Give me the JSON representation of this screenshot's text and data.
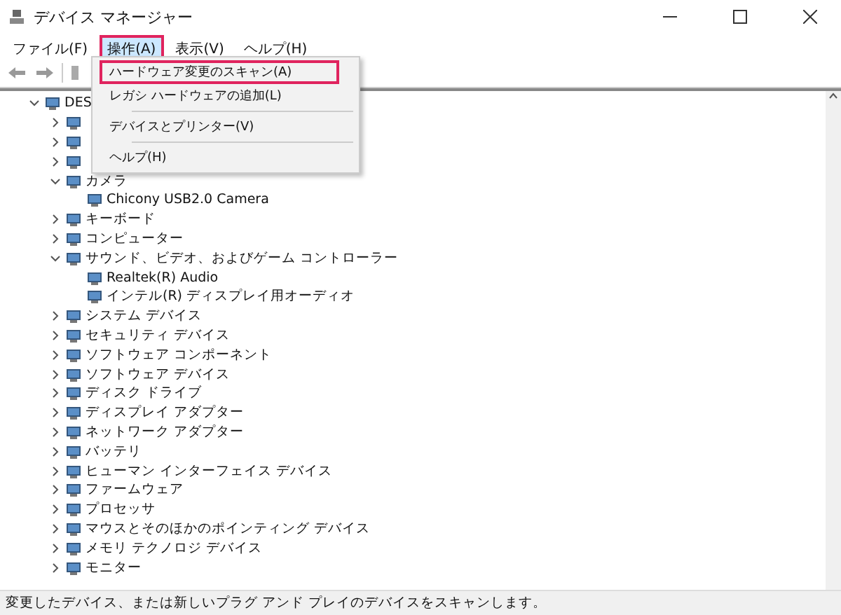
{
  "window": {
    "title": "デバイス マネージャー"
  },
  "menu_bar": [
    {
      "label": "ファイル(F)",
      "selected": false
    },
    {
      "label": "操作(A)",
      "selected": true
    },
    {
      "label": "表示(V)",
      "selected": false
    },
    {
      "label": "ヘルプ(H)",
      "selected": false
    }
  ],
  "dropdown": [
    {
      "kind": "item",
      "label": "ハードウェア変更のスキャン(A)",
      "highlighted": true
    },
    {
      "kind": "item",
      "label": "レガシ ハードウェアの追加(L)",
      "highlighted": false
    },
    {
      "kind": "separator"
    },
    {
      "kind": "item",
      "label": "デバイスとプリンター(V)",
      "highlighted": false
    },
    {
      "kind": "separator"
    },
    {
      "kind": "item",
      "label": "ヘルプ(H)",
      "highlighted": false
    }
  ],
  "tree": [
    {
      "label": "DES",
      "expanded": true,
      "children": [
        {
          "expanded": false
        },
        {
          "expanded": false
        },
        {
          "expanded": false
        },
        {
          "label": "カメラ",
          "expanded": true,
          "children": [
            {
              "label": "Chicony USB2.0 Camera"
            }
          ]
        },
        {
          "label": "キーボード",
          "expanded": false
        },
        {
          "label": "コンピューター",
          "expanded": false
        },
        {
          "label": "サウンド、ビデオ、およびゲーム コントローラー",
          "expanded": true,
          "children": [
            {
              "label": "Realtek(R) Audio"
            },
            {
              "label": "インテル(R) ディスプレイ用オーディオ"
            }
          ]
        },
        {
          "label": "システム デバイス",
          "expanded": false
        },
        {
          "label": "セキュリティ デバイス",
          "expanded": false
        },
        {
          "label": "ソフトウェア コンポーネント",
          "expanded": false
        },
        {
          "label": "ソフトウェア デバイス",
          "expanded": false
        },
        {
          "label": "ディスク ドライブ",
          "expanded": false
        },
        {
          "label": "ディスプレイ アダプター",
          "expanded": false
        },
        {
          "label": "ネットワーク アダプター",
          "expanded": false
        },
        {
          "label": "バッテリ",
          "expanded": false
        },
        {
          "label": "ヒューマン インターフェイス デバイス",
          "expanded": false
        },
        {
          "label": "ファームウェア",
          "expanded": false
        },
        {
          "label": "プロセッサ",
          "expanded": false
        },
        {
          "label": "マウスとそのほかのポインティング デバイス",
          "expanded": false
        },
        {
          "label": "メモリ テクノロジ デバイス",
          "expanded": false
        },
        {
          "label": "モニター",
          "expanded": false
        }
      ]
    }
  ],
  "status_bar": "変更したデバイス、または新しいプラグ アンド プレイのデバイスをスキャンします。"
}
